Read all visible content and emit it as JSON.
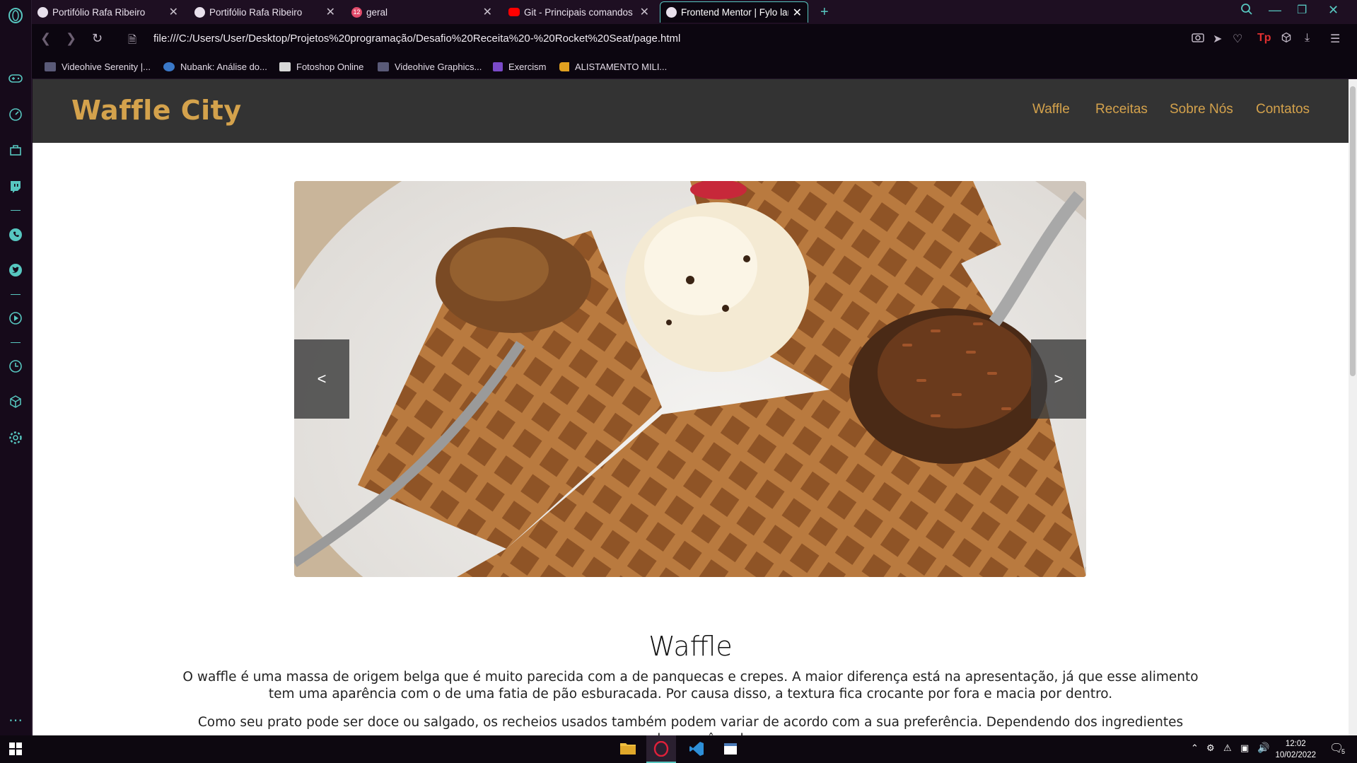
{
  "browser": {
    "tabs": [
      {
        "title": "Portifólio Rafa Ribeiro",
        "active": false
      },
      {
        "title": "Portifólio Rafa Ribeiro",
        "active": false
      },
      {
        "title": "geral",
        "badge": "12",
        "active": false
      },
      {
        "title": "Git - Principais comandos p",
        "active": false
      },
      {
        "title": "Frontend Mentor | Fylo lan",
        "active": true
      }
    ],
    "new_tab": "+",
    "url": "file:///C:/Users/User/Desktop/Projetos%20programação/Desafio%20Receita%20-%20Rocket%20Seat/page.html",
    "bookmarks": [
      {
        "label": "Videohive Serenity |..."
      },
      {
        "label": "Nubank: Análise do..."
      },
      {
        "label": "Fotoshop Online"
      },
      {
        "label": "Videohive Graphics..."
      },
      {
        "label": "Exercism"
      },
      {
        "label": "ALISTAMENTO MILI..."
      }
    ],
    "accent": "#57c7c0"
  },
  "site": {
    "logo": "Waffle City",
    "nav": [
      "Waffle",
      "Receitas",
      "Sobre Nós",
      "Contatos"
    ],
    "brand_color": "#d4a24c",
    "carousel": {
      "prev": "<",
      "next": ">"
    },
    "section_title": "Waffle",
    "paragraphs": [
      "O waffle é uma massa de origem belga que é muito parecida com a de panquecas e crepes. A maior diferença está na apresentação, já que esse alimento tem uma aparência com o de uma fatia de pão esburacada. Por causa disso, a textura fica crocante por fora e macia por dentro.",
      "Como seu prato pode ser doce ou salgado, os recheios usados também podem variar de acordo com a sua preferência. Dependendo dos ingredientes usados, você pode"
    ]
  },
  "taskbar": {
    "time": "12:02",
    "date": "10/02/2022",
    "notifications": "5"
  }
}
